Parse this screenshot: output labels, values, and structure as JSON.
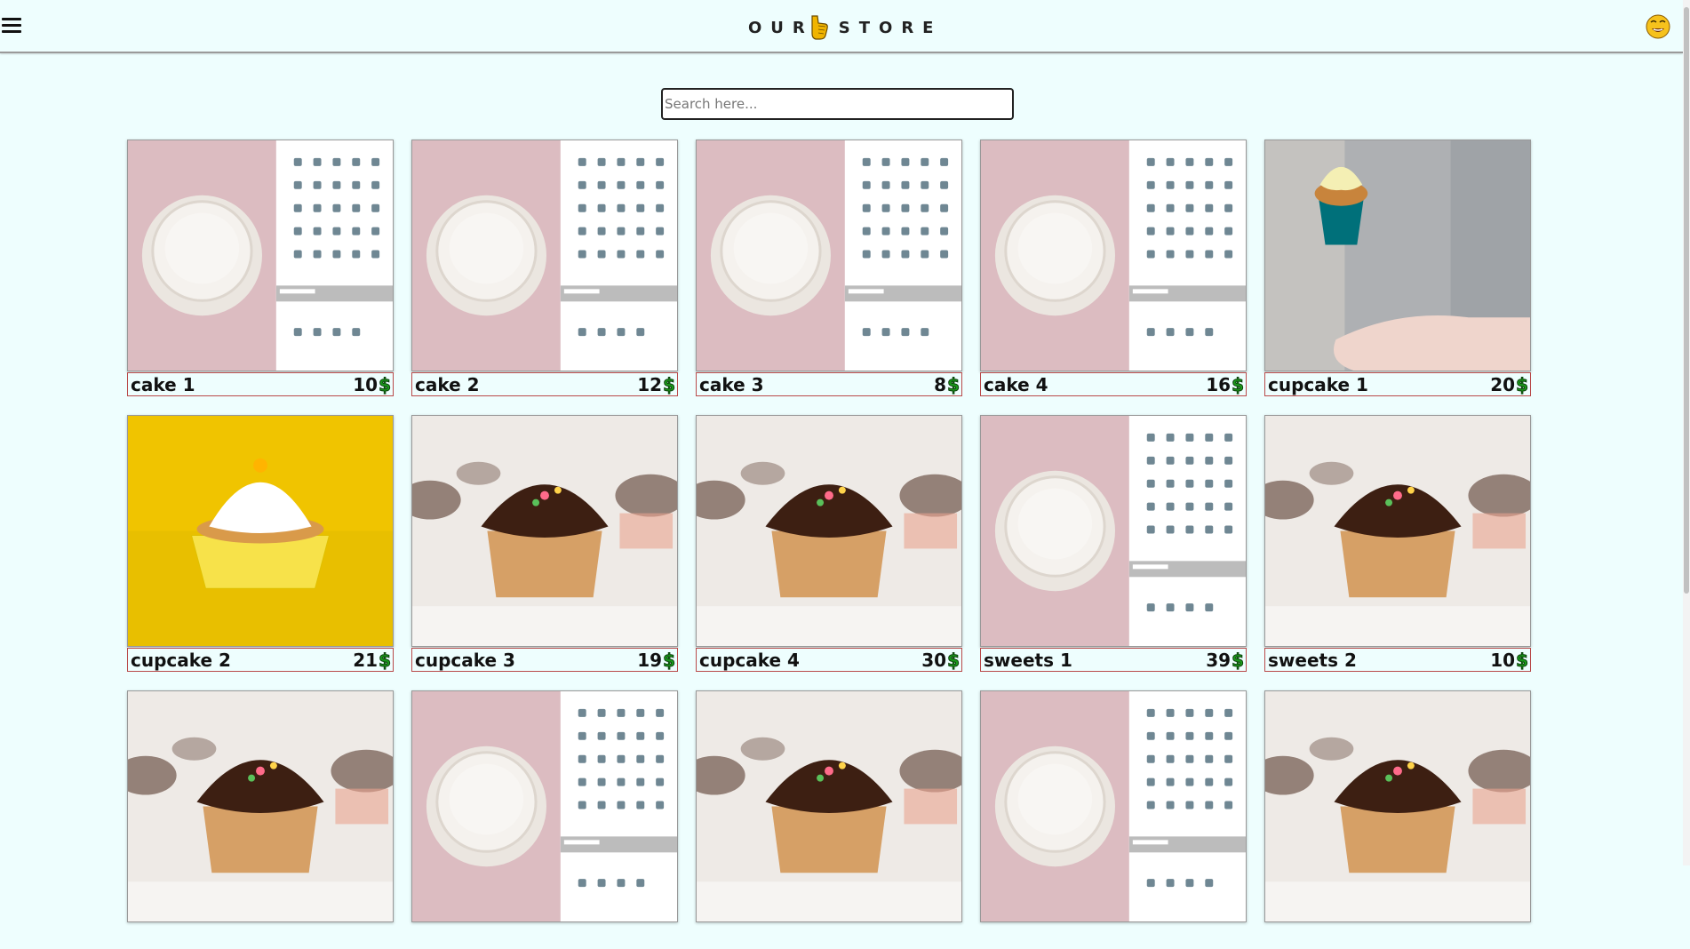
{
  "header": {
    "logo_left": "OUR",
    "logo_right": "STORE",
    "menu_icon": "hamburger-menu-icon",
    "logo_icon": "pointing-hand-icon",
    "avatar_icon": "smiling-face-emoji-icon"
  },
  "search": {
    "placeholder": "Search here...",
    "value": ""
  },
  "currency_symbol": "$",
  "colors": {
    "background": "#eefefe",
    "caption_border": "#b94a4a",
    "price_symbol": "#1a9a1a"
  },
  "products": [
    {
      "name": "cake 1",
      "price": "10",
      "image": "white-cake"
    },
    {
      "name": "cake 2",
      "price": "12",
      "image": "white-cake"
    },
    {
      "name": "cake 3",
      "price": "8",
      "image": "white-cake"
    },
    {
      "name": "cake 4",
      "price": "16",
      "image": "white-cake"
    },
    {
      "name": "cupcake 1",
      "price": "20",
      "image": "cupcake-in-hand"
    },
    {
      "name": "cupcake 2",
      "price": "21",
      "image": "yellow-cupcake"
    },
    {
      "name": "cupcake 3",
      "price": "19",
      "image": "chocolate-cupcake"
    },
    {
      "name": "cupcake 4",
      "price": "30",
      "image": "chocolate-cupcake"
    },
    {
      "name": "sweets 1",
      "price": "39",
      "image": "white-cake"
    },
    {
      "name": "sweets 2",
      "price": "10",
      "image": "chocolate-cupcake"
    },
    {
      "name": "",
      "price": "",
      "image": "chocolate-cupcake"
    },
    {
      "name": "",
      "price": "",
      "image": "white-cake"
    },
    {
      "name": "",
      "price": "",
      "image": "chocolate-cupcake"
    },
    {
      "name": "",
      "price": "",
      "image": "white-cake"
    },
    {
      "name": "",
      "price": "",
      "image": "chocolate-cupcake"
    }
  ]
}
